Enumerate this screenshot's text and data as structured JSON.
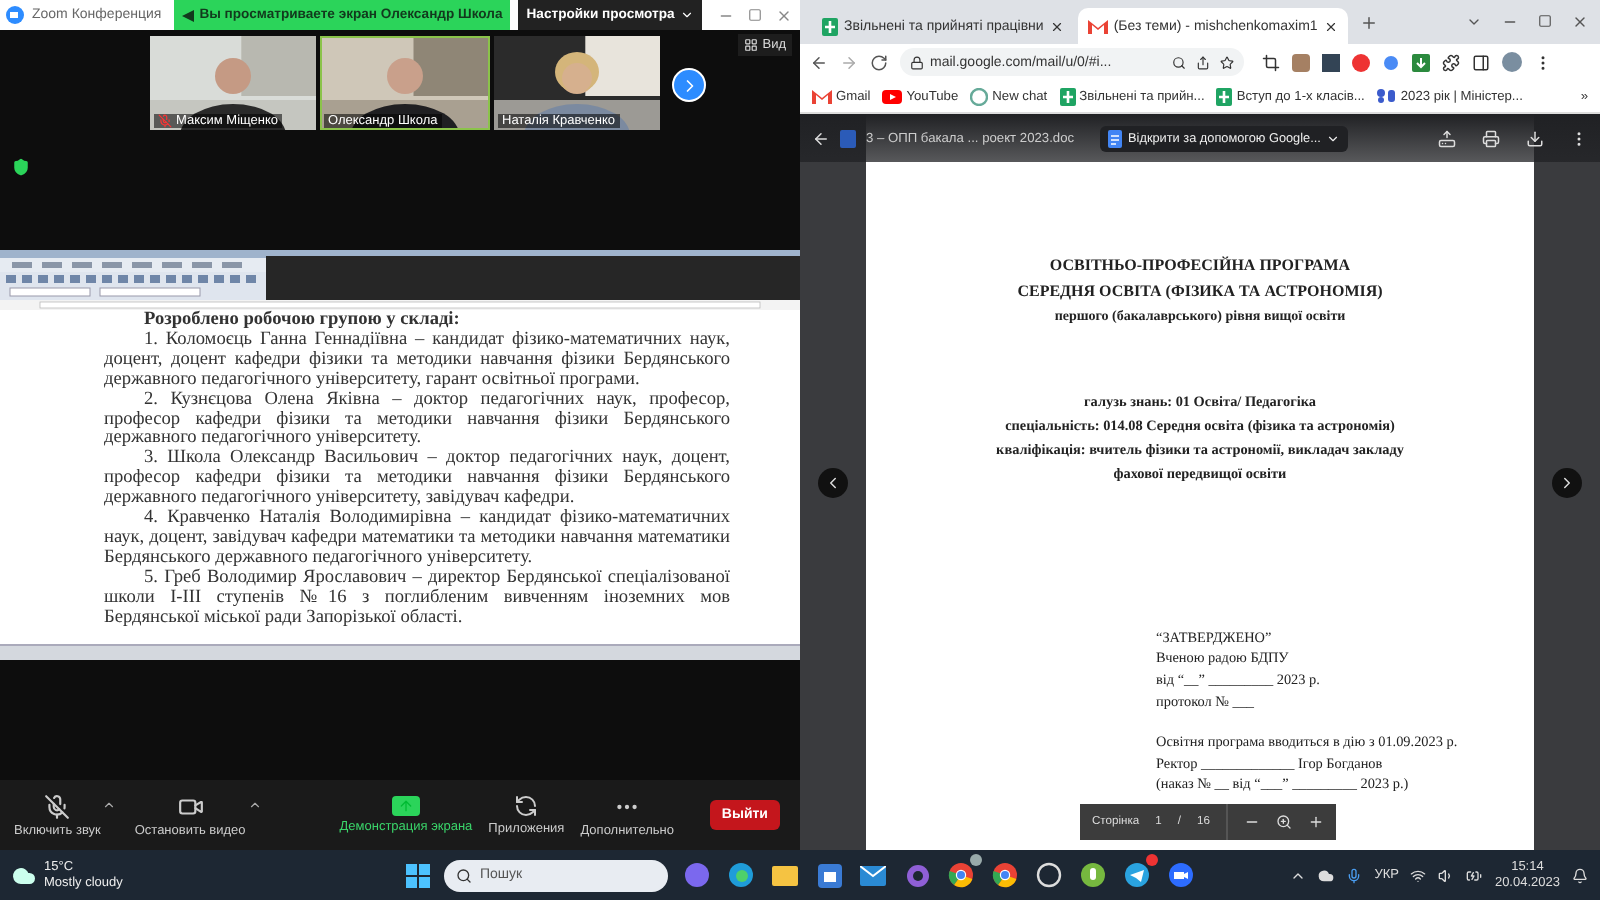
{
  "zoom_window": {
    "title": "Zoom Конференция",
    "banner": "Вы просматриваете экран Олександр Школа",
    "view_settings": "Настройки просмотра",
    "view_button": "Вид",
    "participants": [
      {
        "name": "Максим Міщенко",
        "muted": true,
        "speaking": false
      },
      {
        "name": "Олександр Школа",
        "muted": false,
        "speaking": true
      },
      {
        "name": "Наталія Кравченко",
        "muted": false,
        "speaking": false
      }
    ],
    "shared_document": {
      "heading": "Розроблено робочою групою у складі:",
      "paragraphs": [
        "1. Коломоєць Ганна Геннадіївна – кандидат фізико-математичних наук, доцент, доцент кафедри фізики та методики навчання фізики Бердянського державного педагогічного університету, гарант освітньої програми.",
        "2. Кузнєцова Олена Яківна – доктор педагогічних наук, професор, професор кафедри фізики та методики навчання фізики Бердянського державного педагогічного університету.",
        "3. Школа Олександр Васильович – доктор педагогічних наук, доцент, професор кафедри фізики та методики навчання фізики Бердянського державного педагогічного університету, завідувач кафедри.",
        "4. Кравченко Наталія Володимирівна – кандидат фізико-математичних наук, доцент, завідувач кафедри математики та методики навчання математики Бердянського державного педагогічного університету.",
        "5. Греб Володимир Ярославович – директор Бердянської спеціалізованої школи І-ІІІ ступенів №16 з поглибленим вивченням іноземних мов Бердянської міської ради Запорізької області."
      ]
    },
    "toolbar": [
      {
        "label": "Включить звук",
        "kind": "mic"
      },
      {
        "label": "Остановить видео",
        "kind": "video"
      },
      {
        "label": "Демонстрация экрана",
        "kind": "share"
      },
      {
        "label": "Приложения",
        "kind": "apps"
      },
      {
        "label": "Дополнительно",
        "kind": "more"
      }
    ],
    "leave_button": "Выйти"
  },
  "browser": {
    "tabs": [
      {
        "title": "Звільнені та прийняті працівни",
        "kind": "sheets",
        "selected": false
      },
      {
        "title": "(Без теми) - mishchenkomaxim1",
        "kind": "gmail",
        "selected": true
      }
    ],
    "address": "mail.google.com/mail/u/0/#i...",
    "bookmarks": [
      {
        "label": "Gmail",
        "kind": "gmail"
      },
      {
        "label": "YouTube",
        "kind": "youtube"
      },
      {
        "label": "New chat",
        "kind": "chat"
      },
      {
        "label": "Звільнені та прийн...",
        "kind": "sheets"
      },
      {
        "label": "Вступ до 1-х класів...",
        "kind": "sheets"
      },
      {
        "label": "2023 рік | Міністер...",
        "kind": "ministry"
      }
    ],
    "more_bookmarks": "»",
    "pdf": {
      "file_name": "3 – ОПП бакала ... роект 2023.doc",
      "open_with": "Відкрити за допомогою Google...",
      "title_lines": [
        "ОСВІТНЬО-ПРОФЕСІЙНА ПРОГРАМА",
        "СЕРЕДНЯ ОСВІТА (ФІЗИКА ТА АСТРОНОМІЯ)",
        "першого (бакалаврського) рівня вищої освіти"
      ],
      "field_lines": [
        "галузь знань: 01 Освіта/ Педагогіка",
        "спеціальність: 014.08 Середня освіта (фізика та астрономія)",
        "кваліфікація: вчитель фізики та астрономії, викладач закладу",
        "фахової передвищої освіти"
      ],
      "approval_lines": [
        "“ЗАТВЕРДЖЕНО”",
        "Вченою радою БДПУ",
        "від “__” _________ 2023 р.",
        "протокол № ___"
      ],
      "enactment_lines": [
        "Освітня програма вводиться в дію з 01.09.2023 р.",
        "Ректор _____________ Ігор Богданов",
        "(наказ № __ від “___” _________ 2023 р.)"
      ],
      "page_label": "Сторінка",
      "page": "1",
      "page_separator": "/",
      "page_total": "16"
    }
  },
  "taskbar": {
    "temperature": "15°C",
    "weather": "Mostly cloudy",
    "search_placeholder": "Пошук",
    "language": "УКР",
    "time": "15:14",
    "date": "20.04.2023"
  }
}
